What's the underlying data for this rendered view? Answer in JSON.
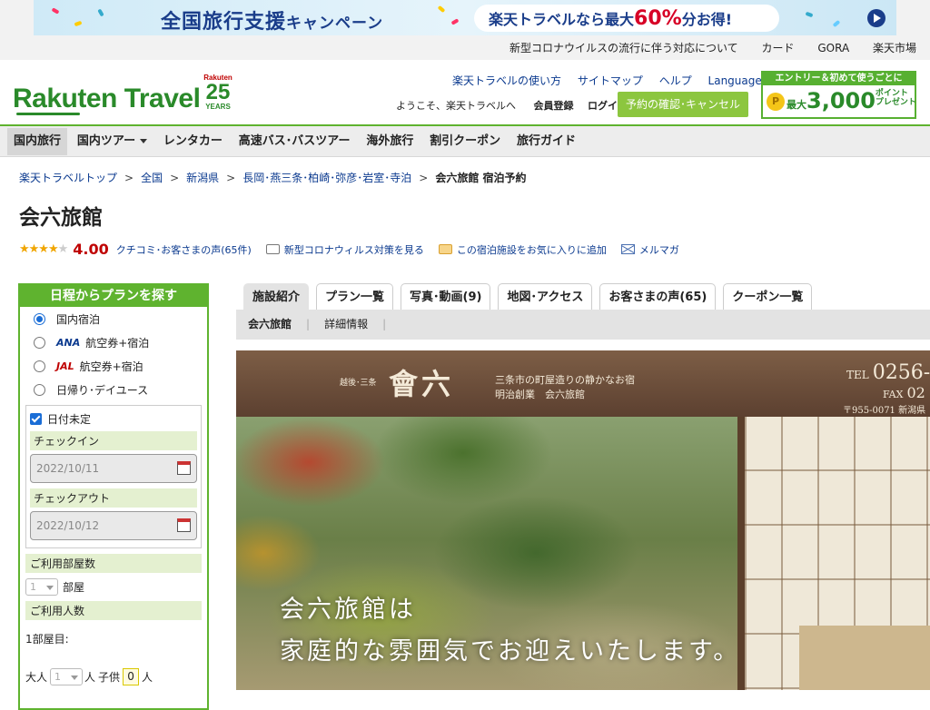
{
  "promo": {
    "title": "全国旅行支援",
    "campaign": "キャンペーン",
    "pill_prefix": "楽天トラベルなら最大",
    "pill_percent": "60%",
    "pill_suffix": "分お得!"
  },
  "util_links": [
    "新型コロナウイルスの流行に伴う対応について",
    "カード",
    "GORA",
    "楽天市場"
  ],
  "header": {
    "logo": "Rakuten Travel",
    "anniv_brand": "Rakuten",
    "anniv_number": "25",
    "anniv_years": "YEARS",
    "links": [
      "楽天トラベルの使い方",
      "サイトマップ",
      "ヘルプ"
    ],
    "languages": "Languages",
    "welcome": "ようこそ、楽天トラベルへ",
    "register": "会員登録",
    "login": "ログイン",
    "confirm_button": "予約の確認･キャンセル",
    "entry_top": "エントリー＆初めて使うごとに",
    "entry_coin": "P",
    "entry_max": "最大",
    "entry_amount": "3,000",
    "entry_point": "ポイント",
    "entry_present": "プレゼント"
  },
  "gnav": [
    {
      "label": "国内旅行",
      "active": true
    },
    {
      "label": "国内ツアー",
      "dropdown": true
    },
    {
      "label": "レンタカー"
    },
    {
      "label": "高速バス･バスツアー"
    },
    {
      "label": "海外旅行"
    },
    {
      "label": "割引クーポン"
    },
    {
      "label": "旅行ガイド"
    }
  ],
  "breadcrumb": [
    "楽天トラベルトップ",
    "全国",
    "新潟県",
    "長岡･燕三条･柏崎･弥彦･岩室･寺泊"
  ],
  "breadcrumb_current": "会六旅館 宿泊予約",
  "breadcrumb_sep": ">",
  "hotel_name": "会六旅館",
  "rating": {
    "stars_filled": 4,
    "stars_total": 5,
    "score": "4.00",
    "reviews_link": "クチコミ･お客さまの声(65件)",
    "covid_link": "新型コロナウィルス対策を見る",
    "favorite_link": "この宿泊施設をお気に入りに追加",
    "mail_link": "メルマガ"
  },
  "sidebar": {
    "title": "日程からプランを探す",
    "options": [
      {
        "label": "国内宿泊",
        "checked": true
      },
      {
        "brand": "ANA",
        "label": "航空券+宿泊"
      },
      {
        "brand": "JAL",
        "label": "航空券+宿泊"
      },
      {
        "label": "日帰り･デイユース"
      }
    ],
    "date_undecided": "日付未定",
    "checkin_label": "チェックイン",
    "checkin_value": "2022/10/11",
    "checkout_label": "チェックアウト",
    "checkout_value": "2022/10/12",
    "rooms_label": "ご利用部屋数",
    "rooms_value": "1",
    "rooms_unit": "部屋",
    "guests_label": "ご利用人数",
    "room1_label": "1部屋目:",
    "adult_label": "大人",
    "adult_value": "1",
    "adult_unit": "人",
    "child_label": "子供",
    "child_value": "0",
    "child_unit": "人"
  },
  "tabs": [
    {
      "label": "施設紹介",
      "active": true
    },
    {
      "label": "プラン一覧"
    },
    {
      "label": "写真･動画(9)"
    },
    {
      "label": "地図･アクセス"
    },
    {
      "label": "お客さまの声(65)"
    },
    {
      "label": "クーポン一覧"
    }
  ],
  "subnav": {
    "active": "会六旅館",
    "sep": "|",
    "detail": "詳細情報"
  },
  "hero": {
    "pre": "越後･三条",
    "kanji": "會六",
    "tag1": "三条市の町屋造りの静かなお宿",
    "tag2": "明治創業　会六旅館",
    "tel_label": "TEL",
    "tel": "0256-",
    "fax_label": "FAX",
    "fax": "02",
    "zip": "〒955-0071 新潟県",
    "copy1": "会六旅館は",
    "copy2": "家庭的な雰囲気でお迎えいたします。"
  },
  "colors": {
    "brand_green": "#5fb32f",
    "accent_red": "#bf0000",
    "link_blue": "#0b3a8f"
  }
}
